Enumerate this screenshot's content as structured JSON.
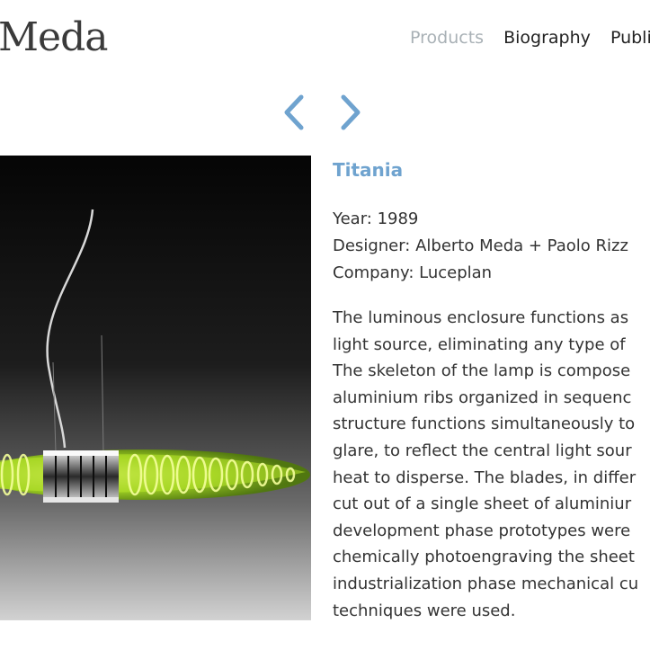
{
  "site": {
    "logo_text": "Meda"
  },
  "nav": {
    "items": [
      {
        "label": "Products",
        "active": true
      },
      {
        "label": "Biography",
        "active": false
      },
      {
        "label": "Publi",
        "active": false
      }
    ]
  },
  "pager": {
    "prev_icon": "chevron-left-icon",
    "next_icon": "chevron-right-icon",
    "color": "#6fa3cf"
  },
  "product": {
    "title": "Titania",
    "year": "Year: 1989",
    "designer": "Designer: Alberto Meda + Paolo Rizz",
    "company": "Company: Luceplan",
    "description_lines": [
      "The luminous enclosure functions as",
      "light source, eliminating any type of",
      "The skeleton of the lamp is compose",
      "aluminium ribs organized in sequenc",
      "structure functions simultaneously to",
      "glare, to reflect the central light sour",
      "heat to disperse. The blades, in differ",
      "cut out of a single sheet of aluminiur",
      "development phase prototypes were",
      "chemically photoengraving the sheet",
      "industrialization phase mechanical cu",
      "techniques were used."
    ]
  },
  "colors": {
    "accent": "#6fa3cf",
    "nav_active": "#a9b1b6",
    "text": "#333333",
    "lamp_glow": "#b8e82a"
  }
}
